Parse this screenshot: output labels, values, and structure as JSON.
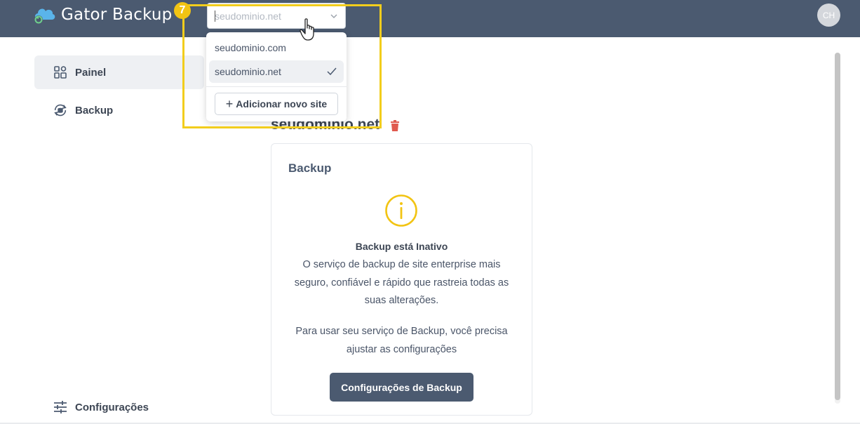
{
  "header": {
    "app_title": "Gator Backup",
    "avatar_initials": "CH",
    "site_select": {
      "value": "seudominio.net",
      "options": [
        "seudominio.com",
        "seudominio.net"
      ],
      "add_site_label": "Adicionar novo site"
    }
  },
  "annotation": {
    "step": "7"
  },
  "sidebar": {
    "items": [
      {
        "label": "Painel",
        "icon": "dashboard-icon",
        "active": true
      },
      {
        "label": "Backup",
        "icon": "backup-icon",
        "active": false
      }
    ],
    "footer_item": {
      "label": "Configurações",
      "icon": "settings-sliders-icon"
    }
  },
  "main": {
    "site_name": "seudominio.net",
    "card": {
      "title": "Backup",
      "status_title": "Backup está Inativo",
      "description": "O serviço de backup de site enterprise mais seguro, confiável e rápido que rastreia todas as suas alterações.",
      "note": "Para usar seu serviço de Backup, você precisa ajustar as configurações",
      "button_label": "Configurações de Backup"
    }
  },
  "colors": {
    "header_bg": "#4b5a70",
    "accent_yellow": "#f2c413",
    "danger": "#e05a4e",
    "primary_button": "#4b5a70"
  }
}
